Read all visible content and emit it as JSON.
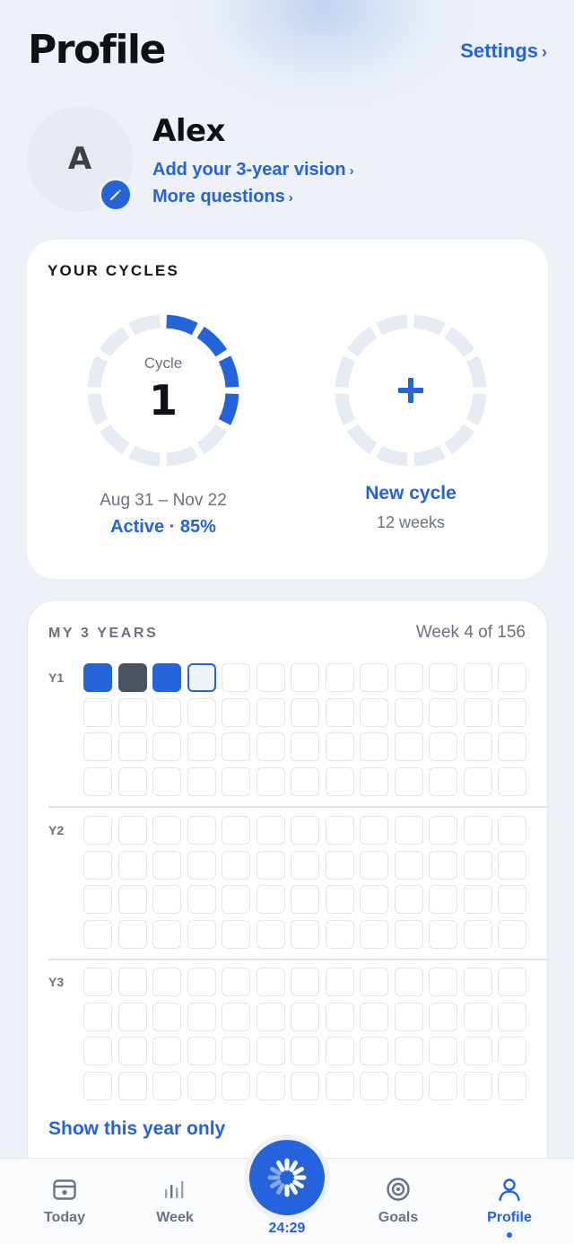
{
  "header": {
    "title": "Profile",
    "settings_label": "Settings",
    "chevron": "›"
  },
  "profile": {
    "avatar_initial": "A",
    "edit_icon": "pencil-icon",
    "name": "Alex",
    "vision_link": "Add your 3-year vision",
    "questions_link": "More questions"
  },
  "cycles": {
    "title": "YOUR CYCLES",
    "current": {
      "label": "Cycle",
      "number": "1",
      "dates": "Aug 31 – Nov 22",
      "status": "Active · 85%",
      "total_segments": 12,
      "filled_segments": 4
    },
    "new": {
      "label": "New cycle",
      "weeks": "12 weeks",
      "icon": "plus-icon"
    }
  },
  "three_years": {
    "title": "MY 3 YEARS",
    "week_count": "Week 4 of 156",
    "years": [
      {
        "label": "Y1",
        "weeks": 52
      },
      {
        "label": "Y2",
        "weeks": 52
      },
      {
        "label": "Y3",
        "weeks": 52
      }
    ],
    "week_states": [
      "done",
      "missed",
      "done",
      "current"
    ],
    "show_year_only": "Show this year only"
  },
  "tabbar": {
    "tabs": [
      {
        "label": "Today",
        "icon": "calendar-icon"
      },
      {
        "label": "Week",
        "icon": "bar-chart-icon"
      },
      {
        "label": "Goals",
        "icon": "target-icon"
      },
      {
        "label": "Profile",
        "icon": "person-icon",
        "active": true
      }
    ],
    "timer": "24:29"
  },
  "colors": {
    "accent": "#2463dc",
    "background": "#eef2f8",
    "missed": "#4b5260",
    "ring_track": "#e6eaf2"
  }
}
